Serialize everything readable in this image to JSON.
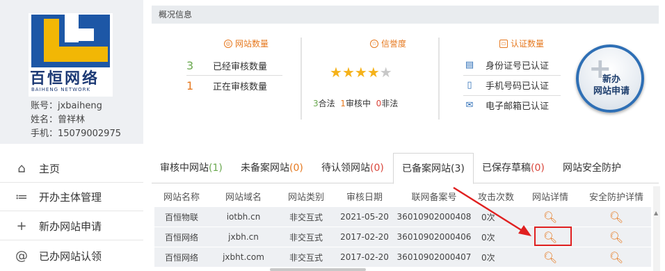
{
  "profile": {
    "logo_cn": "百恒网络",
    "logo_en": "BAIHENG NETWORK",
    "account_line": "账号：jxbaiheng",
    "name_line": "姓名：曾祥林",
    "phone_line": "手机：15079002975"
  },
  "nav": [
    {
      "icon": "home-icon",
      "glyph": "⌂",
      "label": "主页"
    },
    {
      "icon": "list-icon",
      "glyph": "≔",
      "label": "开办主体管理"
    },
    {
      "icon": "plus-icon",
      "glyph": "+",
      "label": "新办网站申请"
    },
    {
      "icon": "at-icon",
      "glyph": "@",
      "label": "已办网站认领"
    }
  ],
  "overview": {
    "title": "概况信息",
    "site_count": {
      "title": "网站数量",
      "rows": [
        {
          "num": "3",
          "label": "已经审核数量",
          "color": "#6aa84f"
        },
        {
          "num": "1",
          "label": "正在审核数量",
          "color": "#e6781e"
        }
      ]
    },
    "credit": {
      "title": "信誉度",
      "stars_on": 4,
      "stars_total": 5,
      "legal_num": "3",
      "legal_label": "合法",
      "review_num": "1",
      "review_label": "审核中",
      "illegal_num": "0",
      "illegal_label": "非法"
    },
    "cert": {
      "title": "认证数量",
      "rows": [
        {
          "icon": "id-card-icon",
          "glyph": "▤",
          "label": "身份证号已认证"
        },
        {
          "icon": "mobile-icon",
          "glyph": "▯",
          "label": "手机号码已认证"
        },
        {
          "icon": "mail-icon",
          "glyph": "✉",
          "label": "电子邮箱已认证"
        }
      ]
    },
    "new_button": {
      "line1": "新办",
      "line2": "网站申请"
    }
  },
  "tabs": [
    {
      "label": "审核中网站",
      "count": "(1)",
      "count_class": "cnt-g"
    },
    {
      "label": "未备案网站",
      "count": "(0)",
      "count_class": "cnt-o"
    },
    {
      "label": "待认领网站",
      "count": "(0)",
      "count_class": "cnt-r"
    },
    {
      "label": "已备案网站(3)",
      "count": "",
      "count_class": ""
    },
    {
      "label": "已保存草稿",
      "count": "(0)",
      "count_class": "cnt-r"
    },
    {
      "label": "网站安全防护",
      "count": "",
      "count_class": ""
    }
  ],
  "table": {
    "headers": [
      "网站名称",
      "网站域名",
      "网站类别",
      "审核日期",
      "联网备案号",
      "攻击次数",
      "网站详情",
      "安全防护详情"
    ],
    "rows": [
      [
        "百恒物联",
        "iotbh.cn",
        "非交互式",
        "2021-05-20",
        "36010902000408",
        "0次"
      ],
      [
        "百恒网络",
        "jxbh.cn",
        "非交互式",
        "2017-02-20",
        "36010902000406",
        "0次"
      ],
      [
        "百恒网络",
        "jxbht.com",
        "非交互式",
        "2017-02-20",
        "36010902000407",
        "0次"
      ]
    ]
  },
  "colors": {
    "accent": "#e6781e",
    "brand_blue": "#2e6fb5",
    "highlight": "#e02020"
  }
}
